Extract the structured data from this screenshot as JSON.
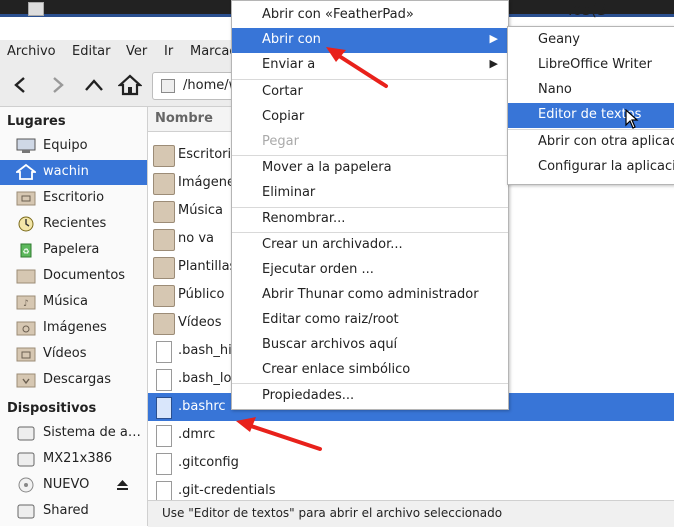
{
  "menubar": [
    "Archivo",
    "Editar",
    "Ver",
    "Ir",
    "Marcadores"
  ],
  "topright_text": "los(3",
  "pathbar": {
    "path": "/home/wachin"
  },
  "sidebar": {
    "lugares_title": "Lugares",
    "lugares": [
      {
        "label": "Equipo",
        "icon": "computer-icon"
      },
      {
        "label": "wachin",
        "icon": "home-icon",
        "selected": true
      },
      {
        "label": "Escritorio",
        "icon": "desktop-folder-icon"
      },
      {
        "label": "Recientes",
        "icon": "clock-icon"
      },
      {
        "label": "Papelera",
        "icon": "trash-icon"
      },
      {
        "label": "Documentos",
        "icon": "folder-icon"
      },
      {
        "label": "Música",
        "icon": "music-folder-icon"
      },
      {
        "label": "Imágenes",
        "icon": "pictures-folder-icon"
      },
      {
        "label": "Vídeos",
        "icon": "video-folder-icon"
      },
      {
        "label": "Descargas",
        "icon": "download-folder-icon"
      }
    ],
    "dispositivos_title": "Dispositivos",
    "dispositivos": [
      {
        "label": "Sistema de archivos",
        "icon": "drive-icon"
      },
      {
        "label": "MX21x386",
        "icon": "drive-icon"
      },
      {
        "label": "NUEVO",
        "icon": "disc-icon",
        "eject": true
      },
      {
        "label": "Shared",
        "icon": "drive-icon"
      }
    ]
  },
  "filelist": {
    "column_name": "Nombre",
    "rows": [
      {
        "label": "Escritorio",
        "type": "folder"
      },
      {
        "label": "Imágenes",
        "type": "folder"
      },
      {
        "label": "Música",
        "type": "folder"
      },
      {
        "label": "no va",
        "type": "folder"
      },
      {
        "label": "Plantillas",
        "type": "folder"
      },
      {
        "label": "Público",
        "type": "folder"
      },
      {
        "label": "Vídeos",
        "type": "folder"
      },
      {
        "label": ".bash_history",
        "type": "file"
      },
      {
        "label": ".bash_logout",
        "type": "file"
      },
      {
        "label": ".bashrc",
        "type": "file",
        "selected": true
      },
      {
        "label": ".dmrc",
        "type": "file"
      },
      {
        "label": ".gitconfig",
        "type": "file"
      },
      {
        "label": ".git-credentials",
        "type": "file"
      }
    ]
  },
  "context_menu": [
    {
      "label": "Abrir con «FeatherPad»"
    },
    {
      "label": "Abrir con",
      "submenu": true,
      "highlighted": true
    },
    {
      "label": "Enviar a",
      "submenu": true
    },
    {
      "label": "Cortar",
      "sep_before": true
    },
    {
      "label": "Copiar"
    },
    {
      "label": "Pegar",
      "disabled": true
    },
    {
      "label": "Mover a la papelera",
      "sep_before": true
    },
    {
      "label": "Eliminar"
    },
    {
      "label": "Renombrar...",
      "sep_before": true
    },
    {
      "label": "Crear un archivador...",
      "sep_before": true
    },
    {
      "label": "Ejecutar orden ..."
    },
    {
      "label": "Abrir Thunar como administrador"
    },
    {
      "label": "Editar como raiz/root"
    },
    {
      "label": "Buscar archivos aquí"
    },
    {
      "label": "Crear enlace simbólico"
    },
    {
      "label": "Propiedades...",
      "sep_before": true
    }
  ],
  "submenu": [
    {
      "label": "Geany"
    },
    {
      "label": "LibreOffice Writer"
    },
    {
      "label": "Nano"
    },
    {
      "label": "Editor de textos",
      "highlighted": true
    },
    {
      "label": "Abrir con otra aplicación...",
      "sep_before": true
    },
    {
      "label": "Configurar la aplicación predeterminada..."
    }
  ],
  "statusbar": "Use \"Editor de textos\" para abrir el archivo seleccionado",
  "colors": {
    "highlight": "#3875d7",
    "arrow": "#e8211b"
  }
}
